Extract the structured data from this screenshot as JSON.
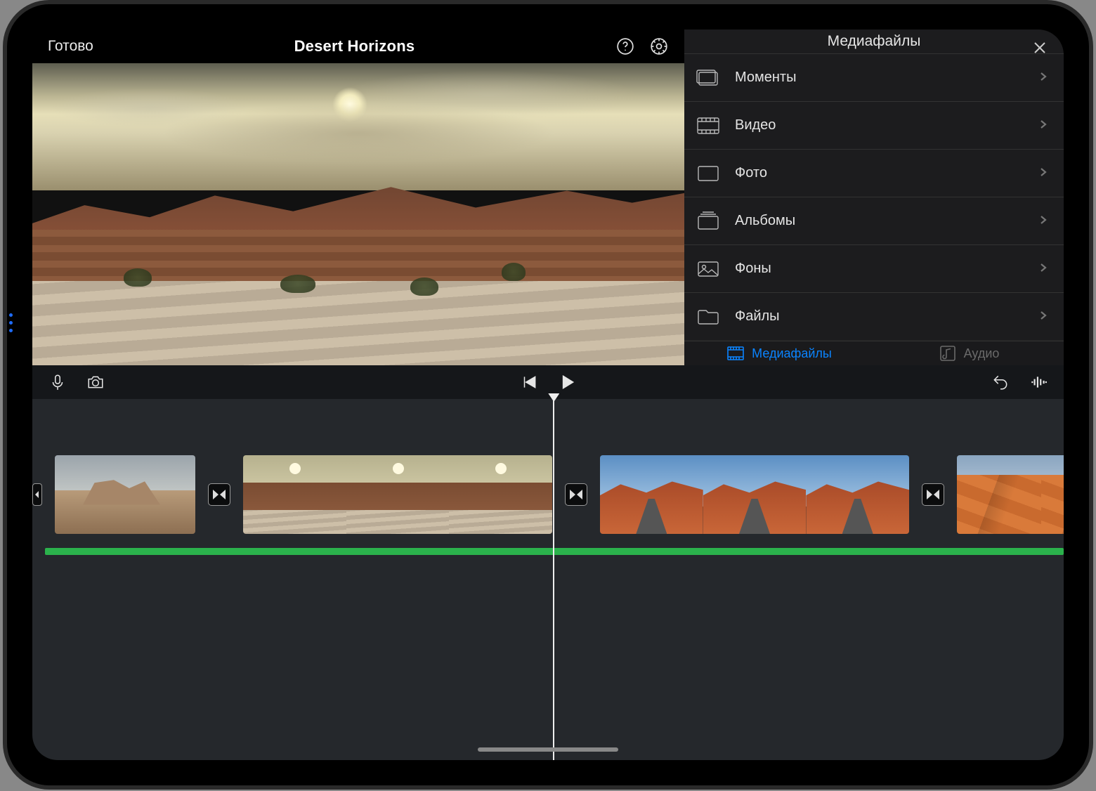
{
  "header": {
    "done_label": "Готово",
    "project_title": "Desert Horizons"
  },
  "media_panel": {
    "title": "Медиафайлы",
    "items": [
      {
        "label": "Моменты",
        "icon": "moments"
      },
      {
        "label": "Видео",
        "icon": "video"
      },
      {
        "label": "Фото",
        "icon": "photo"
      },
      {
        "label": "Альбомы",
        "icon": "albums"
      },
      {
        "label": "Фоны",
        "icon": "backgrounds"
      },
      {
        "label": "Файлы",
        "icon": "files"
      }
    ],
    "tabs": {
      "media_label": "Медиафайлы",
      "audio_label": "Аудио"
    }
  },
  "colors": {
    "accent": "#0b84ff",
    "audio_track": "#2bb24c"
  }
}
